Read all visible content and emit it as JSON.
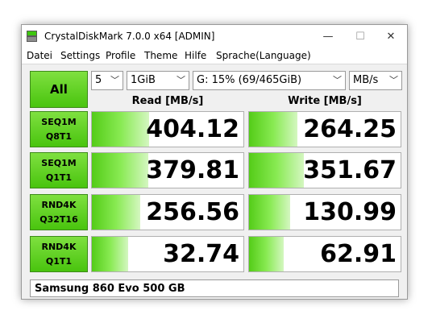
{
  "window": {
    "title": "CrystalDiskMark 7.0.0 x64 [ADMIN]",
    "minimize": "—",
    "maximize": "☐",
    "close": "✕"
  },
  "menu": [
    {
      "label": "Datei"
    },
    {
      "label": "Settings"
    },
    {
      "label": "Profile"
    },
    {
      "label": "Theme"
    },
    {
      "label": "Hilfe"
    },
    {
      "label": "Sprache(Language)"
    }
  ],
  "controls": {
    "all_label": "All",
    "count": "5",
    "size": "1GiB",
    "drive": "G: 15% (69/465GiB)",
    "unit": "MB/s",
    "dropdown_arrow": "﹀"
  },
  "headers": {
    "read": "Read [MB/s]",
    "write": "Write [MB/s]"
  },
  "tests": [
    {
      "line1": "SEQ1M",
      "line2": "Q8T1",
      "read": "404.12",
      "write": "264.25",
      "read_fill": 0.38,
      "write_fill": 0.32
    },
    {
      "line1": "SEQ1M",
      "line2": "Q1T1",
      "read": "379.81",
      "write": "351.67",
      "read_fill": 0.37,
      "write_fill": 0.36
    },
    {
      "line1": "RND4K",
      "line2": "Q32T16",
      "read": "256.56",
      "write": "130.99",
      "read_fill": 0.32,
      "write_fill": 0.27
    },
    {
      "line1": "RND4K",
      "line2": "Q1T1",
      "read": "32.74",
      "write": "62.91",
      "read_fill": 0.24,
      "write_fill": 0.23
    }
  ],
  "comment": "Samsung 860 Evo 500 GB",
  "colors": {
    "button_green": "#49c40e",
    "bar_green": "#54cc18"
  }
}
